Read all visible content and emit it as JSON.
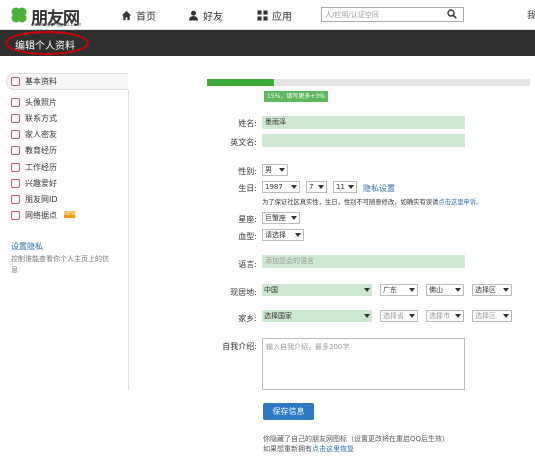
{
  "header": {
    "logo": "朋友网",
    "logo_url": "www.pengyou.com",
    "nav": [
      "首页",
      "好友",
      "应用"
    ],
    "search_placeholder": "人/应用/认证空间",
    "right_cut": "我"
  },
  "titlebar": {
    "title": "编辑个人资料"
  },
  "sidebar": {
    "head": "基本资料",
    "items": [
      "头像照片",
      "联系方式",
      "家人密友",
      "教育经历",
      "工作经历",
      "兴趣爱好",
      "朋友网ID",
      "网络据点"
    ],
    "new_badge": "NEW",
    "privacy_title": "设置隐私",
    "privacy_desc": "控制谁能查看你个人主页上的信息"
  },
  "progress": {
    "percent": 15,
    "tip": "15%，填写更多+3%"
  },
  "form": {
    "name_label": "姓名:",
    "name_value": "墨雨泽",
    "en_label": "英文名:",
    "gender_label": "性别:",
    "gender_value": "男",
    "birth_label": "生日:",
    "birth_year": "1987",
    "birth_month": "7",
    "birth_day": "11",
    "privacy_link": "隐私设置",
    "birth_note": "为了保证社区真实性，生日，性别不可随意修改，如确实有误请",
    "birth_note_link": "点击这里申诉。",
    "zodiac_label": "星座:",
    "zodiac_value": "巨蟹座",
    "blood_label": "血型:",
    "blood_value": "请选择",
    "lang_label": "语言:",
    "lang_placeholder": "添加您会的语言",
    "loc_label": "现居地:",
    "loc_country": "中国",
    "loc_prov": "广东",
    "loc_city": "佛山",
    "loc_dist": "选择区",
    "home_label": "家乡:",
    "home_country": "选择国家",
    "home_prov": "选择省",
    "home_city": "选择市",
    "home_dist": "选择区",
    "intro_label": "自我介绍:",
    "intro_placeholder": "输入自我介绍，最多200字",
    "save": "保存信息",
    "note1": "你隐藏了自己的朋友网图标（设置更改将在重启QQ后生效）",
    "note2_pre": "如果想重新拥有",
    "note2_link": "点击这里恢复"
  }
}
